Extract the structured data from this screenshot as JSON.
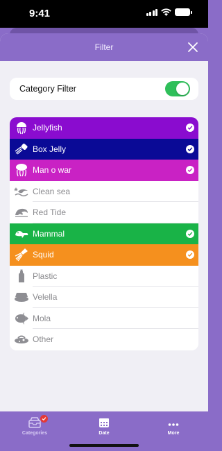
{
  "status_bar": {
    "time": "9:41"
  },
  "sheet": {
    "title": "Filter",
    "close_icon": "close-icon"
  },
  "category_filter": {
    "label": "Category Filter",
    "enabled": true
  },
  "categories": [
    {
      "label": "Jellyfish",
      "selected": true,
      "color": "#8a0ccf",
      "icon": "jellyfish-icon"
    },
    {
      "label": "Box Jelly",
      "selected": true,
      "color": "#0a0a96",
      "icon": "box-jelly-icon"
    },
    {
      "label": "Man o war",
      "selected": true,
      "color": "#c922c4",
      "icon": "man-o-war-icon"
    },
    {
      "label": "Clean sea",
      "selected": false,
      "color": "#ffffff",
      "icon": "clean-sea-icon"
    },
    {
      "label": "Red Tide",
      "selected": false,
      "color": "#ffffff",
      "icon": "red-tide-icon"
    },
    {
      "label": "Mammal",
      "selected": true,
      "color": "#19b347",
      "icon": "mammal-icon"
    },
    {
      "label": "Squid",
      "selected": true,
      "color": "#f5901e",
      "icon": "squid-icon"
    },
    {
      "label": "Plastic",
      "selected": false,
      "color": "#ffffff",
      "icon": "plastic-bottle-icon"
    },
    {
      "label": "Velella",
      "selected": false,
      "color": "#ffffff",
      "icon": "velella-icon"
    },
    {
      "label": "Mola",
      "selected": false,
      "color": "#ffffff",
      "icon": "mola-icon"
    },
    {
      "label": "Other",
      "selected": false,
      "color": "#ffffff",
      "icon": "other-icon"
    }
  ],
  "tabs": [
    {
      "label": "Categories",
      "active": true,
      "icon": "categories-icon",
      "badge": true
    },
    {
      "label": "Date",
      "active": false,
      "icon": "calendar-icon"
    },
    {
      "label": "More",
      "active": false,
      "icon": "more-icon"
    }
  ],
  "colors": {
    "accent": "#8a6cc8",
    "toggle_on": "#2fbf5a",
    "badge": "#e53935"
  }
}
